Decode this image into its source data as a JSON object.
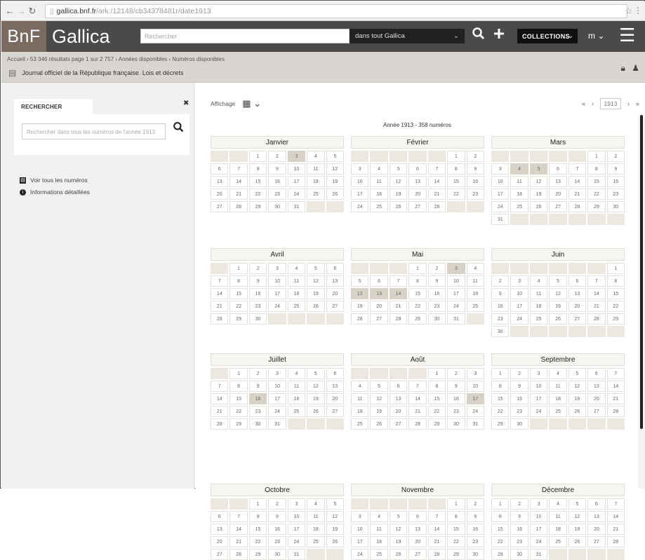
{
  "browser": {
    "url_host": "gallica.bnf.fr",
    "url_path": "/ark:/12148/cb34378481r/date1913",
    "star_icon": "star-icon",
    "menu_icon": "kebab-icon"
  },
  "header": {
    "logo_bnf": "BnF",
    "logo_gallica": "Gallica",
    "search_placeholder": "Rechercher",
    "scope_label": "dans tout Gallica",
    "collections_label": "COLLECTIONS",
    "user_label": "m",
    "colors": {
      "header_bg": "#4a4a4a",
      "logo_bg": "#7a6a60"
    }
  },
  "breadcrumb": {
    "trail": "Accueil › 53 346 résultats page 1 sur 2 757 › Années disponibles › Numéros disponibles",
    "doc_title": "Journal officiel de la République française. Lois et décrets"
  },
  "sidebar": {
    "tab_label": "RECHERCHER",
    "search_placeholder": "Rechercher dans tous les numéros de l'année 1913",
    "links": [
      {
        "label": "Voir tous les numéros",
        "icon": "list-icon"
      },
      {
        "label": "Informations détaillées",
        "icon": "info-icon"
      }
    ]
  },
  "main": {
    "display_label": "Affichage",
    "year": "1913",
    "year_title": "Année 1913 - 358 numéros"
  },
  "calendar": [
    {
      "name": "Janvier",
      "offset": 2,
      "days": 31,
      "highlight": [
        3
      ]
    },
    {
      "name": "Février",
      "offset": 5,
      "days": 28,
      "highlight": []
    },
    {
      "name": "Mars",
      "offset": 5,
      "days": 31,
      "highlight": [
        4,
        5
      ]
    },
    {
      "name": "Avril",
      "offset": 1,
      "days": 30,
      "highlight": []
    },
    {
      "name": "Mai",
      "offset": 3,
      "days": 31,
      "highlight": [
        3,
        12,
        13,
        14
      ]
    },
    {
      "name": "Juin",
      "offset": 6,
      "days": 30,
      "highlight": []
    },
    {
      "name": "Juillet",
      "offset": 1,
      "days": 31,
      "highlight": [
        16
      ]
    },
    {
      "name": "Août",
      "offset": 4,
      "days": 31,
      "highlight": [
        17
      ]
    },
    {
      "name": "Septembre",
      "offset": 0,
      "days": 30,
      "highlight": []
    },
    {
      "name": "Octobre",
      "offset": 2,
      "days": 31,
      "highlight": []
    },
    {
      "name": "Novembre",
      "offset": 5,
      "days": 30,
      "highlight": []
    },
    {
      "name": "Décembre",
      "offset": 0,
      "days": 31,
      "highlight": []
    }
  ]
}
